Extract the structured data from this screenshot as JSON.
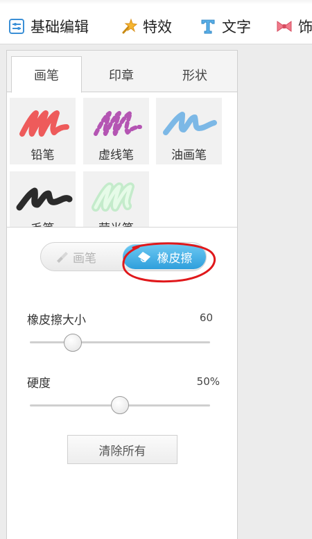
{
  "menubar": {
    "items": [
      {
        "label": "基础编辑",
        "icon": "basic-edit-icon"
      },
      {
        "label": "特效",
        "icon": "magic-wand-icon"
      },
      {
        "label": "文字",
        "icon": "text-t-icon"
      },
      {
        "label": "饰",
        "icon": "bow-decoration-icon"
      }
    ]
  },
  "panel": {
    "tabs": [
      {
        "label": "画笔",
        "active": true
      },
      {
        "label": "印章",
        "active": false
      },
      {
        "label": "形状",
        "active": false
      }
    ],
    "brushes": [
      {
        "label": "铅笔",
        "color": "#ee5b5b",
        "style": "solid"
      },
      {
        "label": "虚线笔",
        "color": "#b455b3",
        "style": "dashed"
      },
      {
        "label": "油画笔",
        "color": "#7cb8e6",
        "style": "solid"
      },
      {
        "label": "毛笔",
        "color": "#2b2b2b",
        "style": "solid"
      },
      {
        "label": "荧光笔",
        "color": "#b8f0c0",
        "style": "glow"
      }
    ],
    "mode_toggle": {
      "brush_label": "画笔",
      "eraser_label": "橡皮擦",
      "selected": "eraser",
      "accent": "#35a6e0"
    },
    "eraser_size": {
      "label": "橡皮擦大小",
      "value": "60",
      "level": 0.24
    },
    "hardness": {
      "label": "硬度",
      "value": "50%",
      "level": 0.5
    },
    "clear_button": "清除所有",
    "annotation_color": "#e0181b"
  }
}
